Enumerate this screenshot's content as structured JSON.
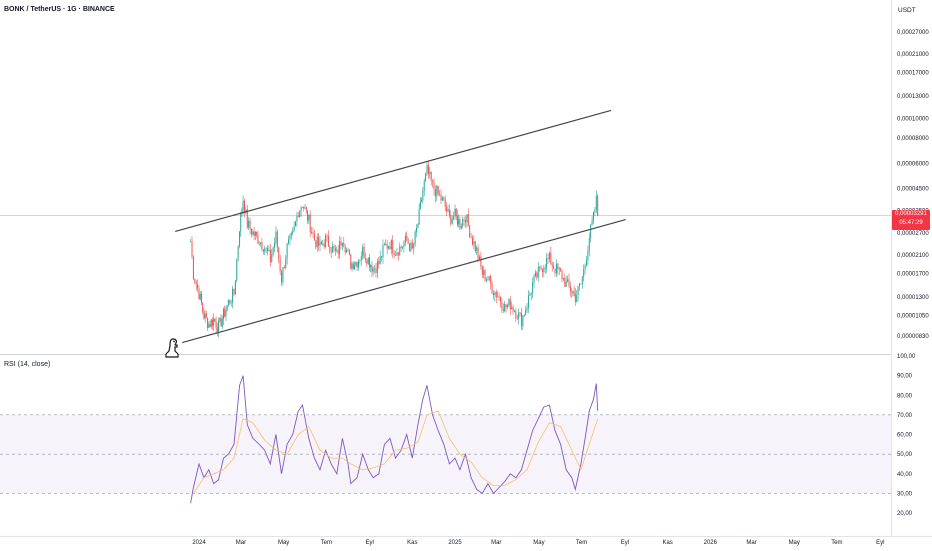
{
  "header": {
    "title": "BONK / TetherUS · 1G · BINANCE"
  },
  "rsi": {
    "label": "RSI (14, close)",
    "axis_ticks": [
      "100,00",
      "90,00",
      "80,00",
      "70,00",
      "60,00",
      "50,00",
      "40,00",
      "30,00",
      "20,00"
    ]
  },
  "price_scale": {
    "currency": "USDT",
    "ticks": [
      "0,00027000",
      "0,00021000",
      "0,00017000",
      "0,00013000",
      "0,00010000",
      "0,00008000",
      "0,00006000",
      "0,00004500",
      "0,00003500",
      "0,00002700",
      "0,00002100",
      "0,00001700",
      "0,00001300",
      "0,00001050",
      "0,00000830"
    ],
    "current_price": "0,00003291",
    "countdown": "05:47:29"
  },
  "time_axis": {
    "labels": [
      "2024",
      "Mar",
      "May",
      "Tem",
      "Eyl",
      "Kas",
      "2025",
      "Mar",
      "May",
      "Tem",
      "Eyl",
      "Kas",
      "2026",
      "Mar",
      "May",
      "Tem",
      "Eyl"
    ]
  },
  "colors": {
    "up": "#26a69a",
    "down": "#ef5350",
    "rsi_line": "#7e57c2",
    "rsi_ma": "#f7c16b",
    "rsi_band": "#7e57c2",
    "trendline": "#434651",
    "price_tag": "#f23645"
  },
  "chart_data": [
    {
      "type": "candlestick",
      "title": "BONK / TetherUS · 1G · BINANCE",
      "scale": "log",
      "y_unit": "USDT",
      "last_price": 3.291e-05,
      "x_range": [
        "2023-12-01",
        "2026-10-01"
      ],
      "y_range": [
        7.5e-06,
        0.00032
      ],
      "close_path": [
        [
          "2023-12-20",
          2.45e-05
        ],
        [
          "2023-12-24",
          1.7e-05
        ],
        [
          "2024-01-01",
          1.35e-05
        ],
        [
          "2024-01-08",
          1.05e-05
        ],
        [
          "2024-01-15",
          9.5e-06
        ],
        [
          "2024-01-22",
          1e-05
        ],
        [
          "2024-01-29",
          9.2e-06
        ],
        [
          "2024-02-05",
          1.05e-05
        ],
        [
          "2024-02-12",
          1.22e-05
        ],
        [
          "2024-02-20",
          1.35e-05
        ],
        [
          "2024-02-28",
          2.9e-05
        ],
        [
          "2024-03-04",
          4e-05
        ],
        [
          "2024-03-10",
          3e-05
        ],
        [
          "2024-03-18",
          2.7e-05
        ],
        [
          "2024-03-27",
          2.5e-05
        ],
        [
          "2024-04-04",
          2.3e-05
        ],
        [
          "2024-04-12",
          2e-05
        ],
        [
          "2024-04-20",
          2.6e-05
        ],
        [
          "2024-04-28",
          1.6e-05
        ],
        [
          "2024-05-06",
          2.3e-05
        ],
        [
          "2024-05-14",
          2.6e-05
        ],
        [
          "2024-05-22",
          3.5e-05
        ],
        [
          "2024-05-28",
          3.8e-05
        ],
        [
          "2024-06-06",
          3.1e-05
        ],
        [
          "2024-06-14",
          2.5e-05
        ],
        [
          "2024-06-22",
          2.3e-05
        ],
        [
          "2024-06-30",
          2.5e-05
        ],
        [
          "2024-07-08",
          2.3e-05
        ],
        [
          "2024-07-16",
          2.1e-05
        ],
        [
          "2024-07-24",
          2.6e-05
        ],
        [
          "2024-08-01",
          2.1e-05
        ],
        [
          "2024-08-05",
          1.9e-05
        ],
        [
          "2024-08-14",
          1.95e-05
        ],
        [
          "2024-08-22",
          2.2e-05
        ],
        [
          "2024-08-30",
          2e-05
        ],
        [
          "2024-09-06",
          1.8e-05
        ],
        [
          "2024-09-14",
          1.9e-05
        ],
        [
          "2024-09-22",
          2.3e-05
        ],
        [
          "2024-09-30",
          2.4e-05
        ],
        [
          "2024-10-08",
          2.2e-05
        ],
        [
          "2024-10-16",
          2.3e-05
        ],
        [
          "2024-10-24",
          2.5e-05
        ],
        [
          "2024-11-01",
          2.2e-05
        ],
        [
          "2024-11-09",
          3e-05
        ],
        [
          "2024-11-16",
          4.4e-05
        ],
        [
          "2024-11-22",
          5.5e-05
        ],
        [
          "2024-11-30",
          4.6e-05
        ],
        [
          "2024-12-08",
          4.2e-05
        ],
        [
          "2024-12-16",
          3.8e-05
        ],
        [
          "2024-12-24",
          3.2e-05
        ],
        [
          "2025-01-01",
          3.3e-05
        ],
        [
          "2025-01-08",
          3e-05
        ],
        [
          "2025-01-16",
          3.3e-05
        ],
        [
          "2025-01-24",
          2.6e-05
        ],
        [
          "2025-02-01",
          2.2e-05
        ],
        [
          "2025-02-09",
          1.7e-05
        ],
        [
          "2025-02-17",
          1.6e-05
        ],
        [
          "2025-02-25",
          1.4e-05
        ],
        [
          "2025-03-05",
          1.3e-05
        ],
        [
          "2025-03-13",
          1.15e-05
        ],
        [
          "2025-03-21",
          1.2e-05
        ],
        [
          "2025-03-29",
          1.1e-05
        ],
        [
          "2025-04-06",
          1e-05
        ],
        [
          "2025-04-14",
          1.2e-05
        ],
        [
          "2025-04-22",
          1.5e-05
        ],
        [
          "2025-04-30",
          1.7e-05
        ],
        [
          "2025-05-08",
          1.9e-05
        ],
        [
          "2025-05-16",
          2e-05
        ],
        [
          "2025-05-24",
          1.8e-05
        ],
        [
          "2025-06-01",
          1.7e-05
        ],
        [
          "2025-06-09",
          1.5e-05
        ],
        [
          "2025-06-17",
          1.4e-05
        ],
        [
          "2025-06-22",
          1.3e-05
        ],
        [
          "2025-06-30",
          1.5e-05
        ],
        [
          "2025-07-06",
          1.9e-05
        ],
        [
          "2025-07-12",
          2.6e-05
        ],
        [
          "2025-07-18",
          3.2e-05
        ],
        [
          "2025-07-22",
          3.9e-05
        ],
        [
          "2025-07-24",
          3.29e-05
        ]
      ],
      "channel": {
        "upper": [
          [
            "2023-11-28",
            2.75e-05
          ],
          [
            "2025-08-12",
            0.00011
          ]
        ],
        "lower": [
          [
            "2023-12-08",
            7.7e-06
          ],
          [
            "2025-09-02",
            3.15e-05
          ]
        ]
      }
    },
    {
      "type": "line",
      "title": "RSI (14, close)",
      "y_range": [
        15,
        100
      ],
      "bands": [
        30,
        50,
        70
      ],
      "series": [
        {
          "values": [
            [
              "2023-12-20",
              25
            ],
            [
              "2023-12-24",
              33
            ],
            [
              "2024-01-01",
              45
            ],
            [
              "2024-01-08",
              38
            ],
            [
              "2024-01-15",
              42
            ],
            [
              "2024-01-22",
              35
            ],
            [
              "2024-01-29",
              37
            ],
            [
              "2024-02-05",
              48
            ],
            [
              "2024-02-12",
              50
            ],
            [
              "2024-02-20",
              55
            ],
            [
              "2024-02-28",
              85
            ],
            [
              "2024-03-04",
              90
            ],
            [
              "2024-03-10",
              65
            ],
            [
              "2024-03-18",
              58
            ],
            [
              "2024-03-27",
              55
            ],
            [
              "2024-04-04",
              52
            ],
            [
              "2024-04-12",
              45
            ],
            [
              "2024-04-20",
              60
            ],
            [
              "2024-04-28",
              40
            ],
            [
              "2024-05-06",
              55
            ],
            [
              "2024-05-14",
              60
            ],
            [
              "2024-05-22",
              72
            ],
            [
              "2024-05-28",
              75
            ],
            [
              "2024-06-06",
              58
            ],
            [
              "2024-06-14",
              48
            ],
            [
              "2024-06-22",
              42
            ],
            [
              "2024-06-30",
              52
            ],
            [
              "2024-07-08",
              45
            ],
            [
              "2024-07-16",
              40
            ],
            [
              "2024-07-24",
              58
            ],
            [
              "2024-08-01",
              45
            ],
            [
              "2024-08-05",
              35
            ],
            [
              "2024-08-14",
              38
            ],
            [
              "2024-08-22",
              50
            ],
            [
              "2024-08-30",
              42
            ],
            [
              "2024-09-06",
              38
            ],
            [
              "2024-09-14",
              40
            ],
            [
              "2024-09-22",
              55
            ],
            [
              "2024-09-30",
              58
            ],
            [
              "2024-10-08",
              48
            ],
            [
              "2024-10-16",
              52
            ],
            [
              "2024-10-24",
              60
            ],
            [
              "2024-11-01",
              48
            ],
            [
              "2024-11-09",
              65
            ],
            [
              "2024-11-16",
              78
            ],
            [
              "2024-11-22",
              85
            ],
            [
              "2024-11-30",
              70
            ],
            [
              "2024-12-08",
              62
            ],
            [
              "2024-12-16",
              55
            ],
            [
              "2024-12-24",
              45
            ],
            [
              "2025-01-01",
              48
            ],
            [
              "2025-01-08",
              42
            ],
            [
              "2025-01-16",
              50
            ],
            [
              "2025-01-24",
              38
            ],
            [
              "2025-02-01",
              32
            ],
            [
              "2025-02-09",
              30
            ],
            [
              "2025-02-17",
              35
            ],
            [
              "2025-02-25",
              30
            ],
            [
              "2025-03-05",
              33
            ],
            [
              "2025-03-13",
              36
            ],
            [
              "2025-03-21",
              40
            ],
            [
              "2025-03-29",
              38
            ],
            [
              "2025-04-06",
              42
            ],
            [
              "2025-04-14",
              52
            ],
            [
              "2025-04-22",
              62
            ],
            [
              "2025-04-30",
              68
            ],
            [
              "2025-05-08",
              74
            ],
            [
              "2025-05-16",
              75
            ],
            [
              "2025-05-24",
              62
            ],
            [
              "2025-06-01",
              55
            ],
            [
              "2025-06-09",
              42
            ],
            [
              "2025-06-17",
              38
            ],
            [
              "2025-06-22",
              32
            ],
            [
              "2025-06-30",
              45
            ],
            [
              "2025-07-06",
              58
            ],
            [
              "2025-07-12",
              72
            ],
            [
              "2025-07-18",
              78
            ],
            [
              "2025-07-22",
              86
            ],
            [
              "2025-07-24",
              72
            ]
          ]
        },
        {
          "values": [
            [
              "2023-12-24",
              30
            ],
            [
              "2024-01-08",
              38
            ],
            [
              "2024-01-22",
              40
            ],
            [
              "2024-02-05",
              42
            ],
            [
              "2024-02-20",
              48
            ],
            [
              "2024-03-04",
              68
            ],
            [
              "2024-03-18",
              66
            ],
            [
              "2024-04-04",
              57
            ],
            [
              "2024-04-20",
              52
            ],
            [
              "2024-05-06",
              50
            ],
            [
              "2024-05-22",
              60
            ],
            [
              "2024-06-06",
              64
            ],
            [
              "2024-06-22",
              52
            ],
            [
              "2024-07-08",
              48
            ],
            [
              "2024-07-24",
              48
            ],
            [
              "2024-08-05",
              45
            ],
            [
              "2024-08-22",
              42
            ],
            [
              "2024-09-06",
              43
            ],
            [
              "2024-09-22",
              45
            ],
            [
              "2024-10-08",
              52
            ],
            [
              "2024-10-24",
              53
            ],
            [
              "2024-11-09",
              56
            ],
            [
              "2024-11-22",
              70
            ],
            [
              "2024-12-08",
              72
            ],
            [
              "2024-12-24",
              58
            ],
            [
              "2025-01-08",
              50
            ],
            [
              "2025-01-24",
              46
            ],
            [
              "2025-02-09",
              38
            ],
            [
              "2025-02-25",
              34
            ],
            [
              "2025-03-13",
              34
            ],
            [
              "2025-03-29",
              37
            ],
            [
              "2025-04-14",
              42
            ],
            [
              "2025-04-30",
              56
            ],
            [
              "2025-05-16",
              66
            ],
            [
              "2025-06-01",
              64
            ],
            [
              "2025-06-17",
              52
            ],
            [
              "2025-06-30",
              42
            ],
            [
              "2025-07-12",
              55
            ],
            [
              "2025-07-24",
              68
            ]
          ]
        }
      ]
    }
  ]
}
